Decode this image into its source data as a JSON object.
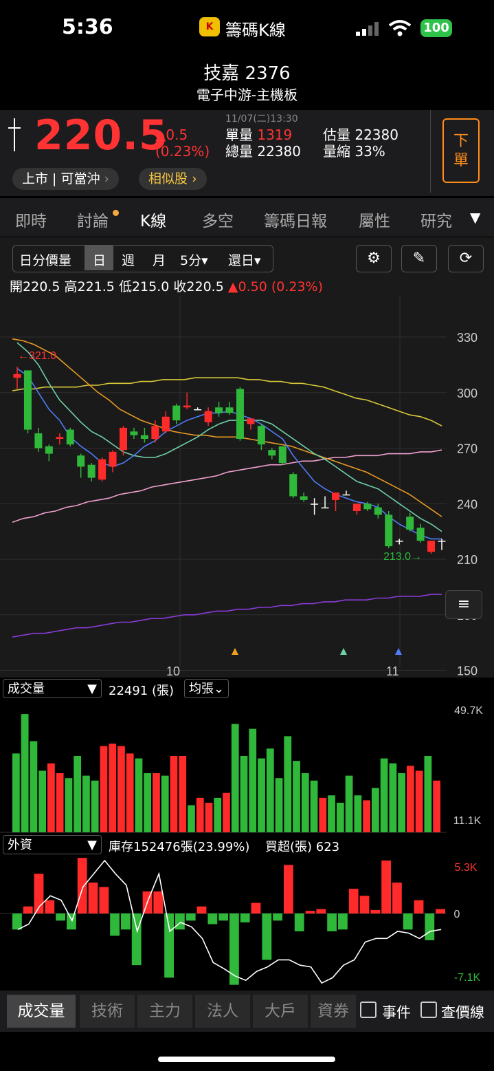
{
  "status": {
    "time": "5:36",
    "app_name": "籌碼K線",
    "app_icon_text": "K",
    "battery": "100"
  },
  "header": {
    "title": "技嘉 2376",
    "subtitle": "電子中游-主機板"
  },
  "quote": {
    "datetime": "11/07(二)13:30",
    "price": "220.5",
    "change": "▲0.5",
    "change_pct": "(0.23%)",
    "single_vol_label": "單量",
    "single_vol": "1319",
    "total_vol_label": "總量",
    "total_vol": "22380",
    "est_vol_label": "估量",
    "est_vol": "22380",
    "vol_ratio_label": "量縮",
    "vol_ratio": "33%",
    "market_tag": "上市 | 可當沖",
    "similar": "相似股",
    "sell_label": "下單"
  },
  "tabs": [
    "即時",
    "討論",
    "K線",
    "多空",
    "籌碼日報",
    "屬性",
    "研究"
  ],
  "active_tab": "K線",
  "toolbar": {
    "items": [
      "日分價量",
      "日",
      "週",
      "月",
      "5分▾",
      "還日▾"
    ],
    "active": "日"
  },
  "ohlc": {
    "open_label": "開",
    "open": "220.5",
    "high_label": "高",
    "high": "221.5",
    "low_label": "低",
    "low": "215.0",
    "close_label": "收",
    "close": "220.5",
    "change": "▲0.50 (0.23%)"
  },
  "kline": {
    "y_ticks": [
      "330",
      "300",
      "270",
      "240",
      "210",
      "180",
      "150"
    ],
    "x_ticks": [
      "10",
      "11"
    ],
    "max_label": "←321.0",
    "min_label": "213.0→",
    "colors": {
      "up": "#ff2a2a",
      "down": "#2fb83a",
      "ma5": "#4f7df9",
      "ma10": "#6fd0a8",
      "ma20": "#e89a22",
      "ma60": "#d8c83a",
      "ma120": "#f0a0d0",
      "ma240": "#8a3bd8"
    }
  },
  "volume": {
    "selector": "成交量",
    "value": "22491 (張)",
    "mode": "均張",
    "top": "49.7K",
    "bottom": "11.1K"
  },
  "foreign": {
    "selector": "外資",
    "inventory": "庫存152476張(23.99%)",
    "net": "買超(張) 623",
    "top": "5.3K",
    "zero": "0",
    "bottom": "-7.1K"
  },
  "bottom_tabs": [
    "成交量",
    "技術",
    "主力",
    "法人",
    "大戶",
    "資券"
  ],
  "checkboxes": [
    "事件",
    "查價線"
  ],
  "chart_data": [
    {
      "type": "candlestick",
      "title": "",
      "ylim": [
        150,
        340
      ],
      "x_ticks": [
        "10",
        "11"
      ],
      "candles": [
        {
          "o": 308,
          "h": 314,
          "l": 302,
          "c": 310
        },
        {
          "o": 312,
          "h": 312,
          "l": 278,
          "c": 280
        },
        {
          "o": 278,
          "h": 281,
          "l": 268,
          "c": 270
        },
        {
          "o": 271,
          "h": 272,
          "l": 263,
          "c": 267
        },
        {
          "o": 275,
          "h": 278,
          "l": 272,
          "c": 276
        },
        {
          "o": 280,
          "h": 281,
          "l": 271,
          "c": 272
        },
        {
          "o": 266,
          "h": 267,
          "l": 254,
          "c": 260
        },
        {
          "o": 261,
          "h": 262,
          "l": 252,
          "c": 254
        },
        {
          "o": 253,
          "h": 265,
          "l": 252,
          "c": 264
        },
        {
          "o": 260,
          "h": 269,
          "l": 257,
          "c": 268
        },
        {
          "o": 269,
          "h": 282,
          "l": 266,
          "c": 281
        },
        {
          "o": 279,
          "h": 281,
          "l": 275,
          "c": 277
        },
        {
          "o": 277,
          "h": 281,
          "l": 273,
          "c": 275
        },
        {
          "o": 275,
          "h": 285,
          "l": 273,
          "c": 282
        },
        {
          "o": 279,
          "h": 290,
          "l": 278,
          "c": 287
        },
        {
          "o": 293,
          "h": 294,
          "l": 283,
          "c": 285
        },
        {
          "o": 292,
          "h": 300,
          "l": 291,
          "c": 293
        },
        {
          "o": 291,
          "h": 292,
          "l": 291,
          "c": 291
        },
        {
          "o": 284,
          "h": 292,
          "l": 282,
          "c": 290
        },
        {
          "o": 292,
          "h": 295,
          "l": 287,
          "c": 289
        },
        {
          "o": 292,
          "h": 295,
          "l": 288,
          "c": 289
        },
        {
          "o": 302,
          "h": 303,
          "l": 274,
          "c": 275
        },
        {
          "o": 283,
          "h": 286,
          "l": 280,
          "c": 286
        },
        {
          "o": 282,
          "h": 283,
          "l": 269,
          "c": 272
        },
        {
          "o": 269,
          "h": 270,
          "l": 264,
          "c": 266
        },
        {
          "o": 271,
          "h": 271,
          "l": 261,
          "c": 262
        },
        {
          "o": 256,
          "h": 257,
          "l": 243,
          "c": 244
        },
        {
          "o": 244,
          "h": 246,
          "l": 241,
          "c": 242
        },
        {
          "o": 240,
          "h": 243,
          "l": 234,
          "c": 240
        },
        {
          "o": 238,
          "h": 244,
          "l": 238,
          "c": 238
        },
        {
          "o": 242,
          "h": 245,
          "l": 236,
          "c": 246
        },
        {
          "o": 245,
          "h": 247,
          "l": 245,
          "c": 245
        },
        {
          "o": 236,
          "h": 238,
          "l": 234,
          "c": 240
        },
        {
          "o": 240,
          "h": 241,
          "l": 236,
          "c": 237
        },
        {
          "o": 238,
          "h": 240,
          "l": 232,
          "c": 234
        },
        {
          "o": 234,
          "h": 236,
          "l": 216,
          "c": 217
        },
        {
          "o": 220,
          "h": 221,
          "l": 218,
          "c": 220
        },
        {
          "o": 233,
          "h": 235,
          "l": 225,
          "c": 226
        },
        {
          "o": 227,
          "h": 229,
          "l": 219,
          "c": 220
        },
        {
          "o": 214,
          "h": 220,
          "l": 213,
          "c": 220
        },
        {
          "o": 220,
          "h": 221,
          "l": 215,
          "c": 220
        }
      ],
      "ma5": [
        313,
        309,
        300,
        291,
        285,
        276,
        271,
        267,
        262,
        260,
        262,
        266,
        271,
        274,
        279,
        282,
        285,
        287,
        289,
        289,
        290,
        288,
        286,
        283,
        279,
        275,
        266,
        259,
        252,
        248,
        245,
        243,
        241,
        240,
        238,
        233,
        229,
        226,
        223,
        221,
        221
      ],
      "ma10": [
        327,
        322,
        315,
        305,
        296,
        290,
        284,
        279,
        276,
        272,
        268,
        266,
        265,
        265,
        267,
        270,
        273,
        276,
        280,
        283,
        285,
        285,
        285,
        285,
        283,
        279,
        275,
        271,
        267,
        264,
        260,
        256,
        252,
        250,
        248,
        244,
        240,
        236,
        232,
        229,
        225
      ],
      "ma20": [
        329,
        328,
        326,
        323,
        320,
        315,
        310,
        305,
        300,
        296,
        291,
        288,
        285,
        283,
        281,
        279,
        278,
        277,
        277,
        276,
        276,
        276,
        275,
        274,
        273,
        272,
        271,
        269,
        267,
        265,
        263,
        261,
        259,
        257,
        254,
        251,
        248,
        245,
        241,
        237,
        233
      ],
      "ma60": [
        301,
        302,
        302,
        303,
        303,
        303,
        303,
        304,
        304,
        305,
        305,
        305,
        306,
        306,
        307,
        307,
        307,
        308,
        308,
        308,
        308,
        308,
        307,
        307,
        306,
        306,
        305,
        305,
        304,
        303,
        301,
        299,
        297,
        296,
        294,
        292,
        290,
        288,
        287,
        285,
        282
      ],
      "ma120": [
        230,
        232,
        233,
        235,
        236,
        238,
        239,
        241,
        242,
        243,
        245,
        246,
        247,
        249,
        250,
        251,
        252,
        253,
        254,
        255,
        257,
        258,
        259,
        260,
        261,
        261,
        262,
        263,
        263,
        264,
        265,
        265,
        266,
        266,
        266,
        267,
        267,
        267,
        268,
        268,
        269
      ],
      "ma240": [
        168,
        169,
        170,
        170,
        171,
        172,
        173,
        173,
        174,
        175,
        176,
        176,
        177,
        178,
        178,
        179,
        180,
        180,
        181,
        182,
        182,
        183,
        183,
        184,
        184,
        185,
        185,
        186,
        186,
        187,
        187,
        188,
        188,
        188,
        189,
        189,
        190,
        190,
        190,
        191,
        191
      ]
    },
    {
      "type": "bar",
      "title": "",
      "ylim": [
        11.1,
        49.7
      ],
      "unit": "K",
      "values": [
        32,
        48,
        37,
        25,
        28,
        24,
        22,
        31,
        23,
        21,
        35,
        36,
        35,
        32,
        30,
        24,
        24,
        23,
        31,
        31,
        11,
        14,
        12,
        14,
        16,
        44,
        31,
        42,
        30,
        34,
        22,
        39,
        29,
        24,
        21,
        14,
        15,
        12,
        23,
        15,
        13,
        18,
        30,
        28,
        24,
        27,
        25,
        31,
        21
      ],
      "colors": [
        "g",
        "g",
        "g",
        "g",
        "r",
        "r",
        "g",
        "g",
        "g",
        "g",
        "r",
        "r",
        "r",
        "r",
        "g",
        "g",
        "r",
        "g",
        "r",
        "r",
        "g",
        "r",
        "r",
        "g",
        "r",
        "g",
        "g",
        "g",
        "g",
        "g",
        "g",
        "g",
        "g",
        "g",
        "g",
        "r",
        "g",
        "g",
        "g",
        "g",
        "r",
        "g",
        "g",
        "g",
        "g",
        "r",
        "r",
        "g",
        "r"
      ]
    },
    {
      "type": "bar+line",
      "title": "",
      "ylim": [
        -7.1,
        5.3
      ],
      "values": [
        -1.8,
        0.8,
        4.5,
        1.5,
        -0.8,
        -1.8,
        6.3,
        3.5,
        3.0,
        -2.5,
        -1.8,
        -5.8,
        2.5,
        2.5,
        -7.2,
        -1.8,
        -0.8,
        0.8,
        -1.2,
        -0.8,
        -8.0,
        -1.0,
        1.2,
        -5.2,
        -0.8,
        5.5,
        -2.0,
        0.3,
        0.5,
        -2.0,
        -1.8,
        2.8,
        2.0,
        0.4,
        6.0,
        3.5,
        -1.8,
        1.5,
        -3.0,
        0.5
      ],
      "line": [
        -1.8,
        -1.2,
        0.8,
        2.0,
        1.5,
        -0.8,
        3.0,
        4.5,
        6.0,
        4.5,
        3.2,
        -2.0,
        1.5,
        4.5,
        -2.0,
        -1.0,
        -1.5,
        -2.8,
        -5.5,
        -6.2,
        -7.0,
        -7.5,
        -6.5,
        -6.0,
        -5.2,
        -5.2,
        -5.8,
        -6.0,
        -7.8,
        -7.2,
        -5.8,
        -5.2,
        -3.2,
        -2.8,
        -2.8,
        -2.0,
        -2.2,
        -2.8,
        -2.0,
        -1.8
      ],
      "colors": [
        "g",
        "r",
        "r",
        "r",
        "g",
        "g",
        "r",
        "r",
        "r",
        "g",
        "g",
        "g",
        "r",
        "r",
        "g",
        "g",
        "g",
        "r",
        "g",
        "g",
        "g",
        "g",
        "r",
        "g",
        "g",
        "r",
        "g",
        "r",
        "r",
        "g",
        "g",
        "r",
        "r",
        "r",
        "r",
        "r",
        "g",
        "r",
        "g",
        "r"
      ]
    }
  ]
}
